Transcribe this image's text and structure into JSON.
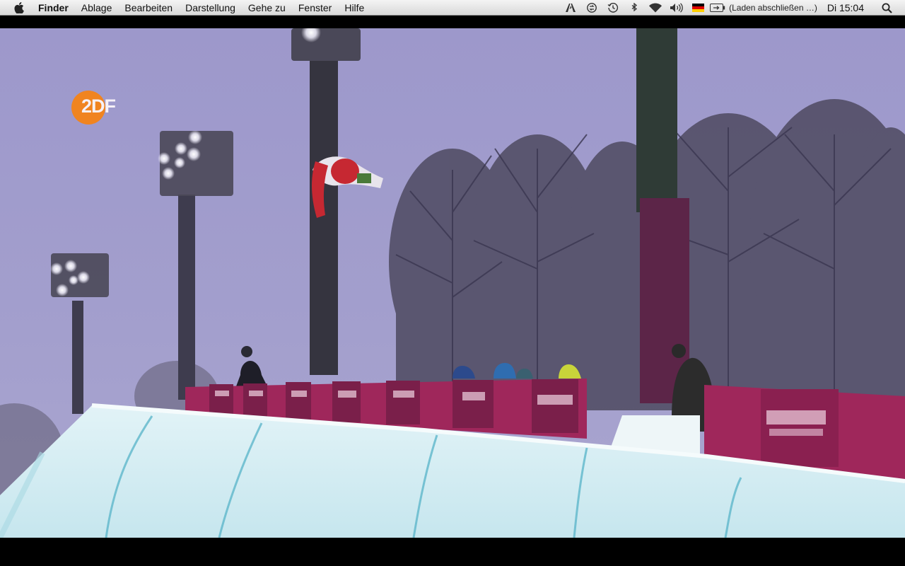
{
  "menubar": {
    "apple_icon": "apple-logo-icon",
    "app_name": "Finder",
    "menus": [
      "Ablage",
      "Bearbeiten",
      "Darstellung",
      "Gehe zu",
      "Fenster",
      "Hilfe"
    ],
    "status_icons": [
      "adobe-icon",
      "sync-icon",
      "time-machine-icon",
      "bluetooth-icon",
      "wifi-icon",
      "volume-icon",
      "german-flag-icon",
      "battery-icon"
    ],
    "battery_status": "(Laden abschließen …)",
    "clock": "Di 15:04",
    "spotlight_icon": "spotlight-search-icon"
  },
  "video": {
    "channel_logo": "2DF",
    "content": "snowboard-halfpipe-broadcast"
  },
  "colors": {
    "menubar_bg": "#e6e6e6",
    "sky": "#9c97c9",
    "snow": "#d6eef2",
    "pipe_blue": "#57b4c8",
    "banner_magenta": "#a8285e",
    "logo_orange": "#f08420"
  }
}
